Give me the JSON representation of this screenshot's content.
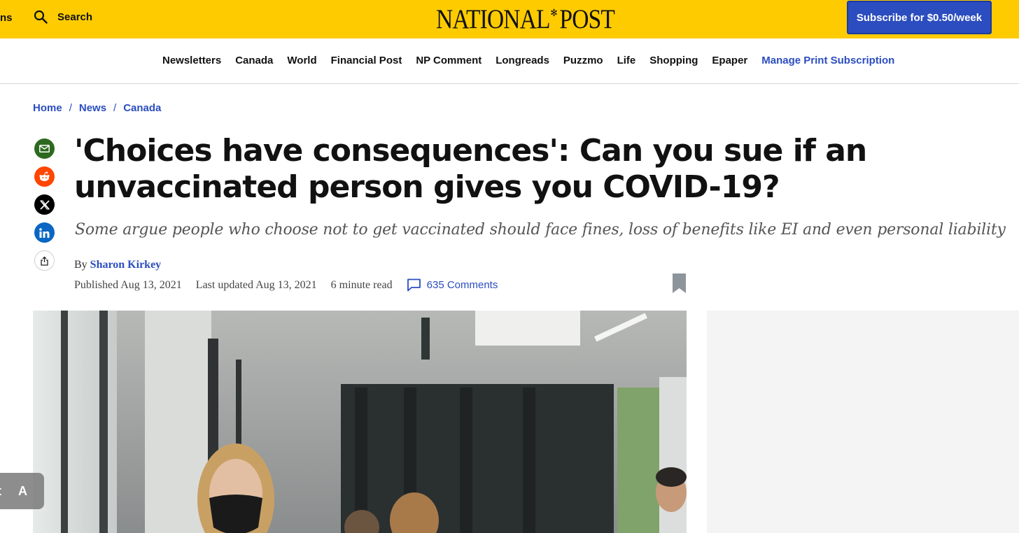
{
  "header": {
    "partial_left_text": "ns",
    "search_label": "Search",
    "logo_left": "NATIONAL",
    "logo_right": "POST",
    "subscribe_label": "Subscribe for $0.50/week"
  },
  "nav": {
    "items": [
      "Newsletters",
      "Canada",
      "World",
      "Financial Post",
      "NP Comment",
      "Longreads",
      "Puzzmo",
      "Life",
      "Shopping",
      "Epaper",
      "Manage Print Subscription"
    ]
  },
  "breadcrumb": {
    "items": [
      "Home",
      "News",
      "Canada"
    ],
    "separator": "/"
  },
  "article": {
    "headline": "'Choices have consequences': Can you sue if an unvaccinated person gives you COVID-19?",
    "subhead": "Some argue people who choose not to get vaccinated should face fines, loss of benefits like EI and even personal liability",
    "byline_prefix": "By",
    "author": "Sharon Kirkey",
    "published": "Published Aug 13, 2021",
    "updated": "Last updated Aug 13, 2021",
    "read_time": "6 minute read",
    "comments": "635 Comments"
  },
  "float_tab": {
    "left_char": "t",
    "right_char": "A"
  },
  "colors": {
    "header_yellow": "#fecb00",
    "brand_blue": "#2b4dbf"
  },
  "icons": [
    "search-icon",
    "email-icon",
    "reddit-icon",
    "x-icon",
    "linkedin-icon",
    "share-icon",
    "comment-icon",
    "bookmark-icon"
  ]
}
